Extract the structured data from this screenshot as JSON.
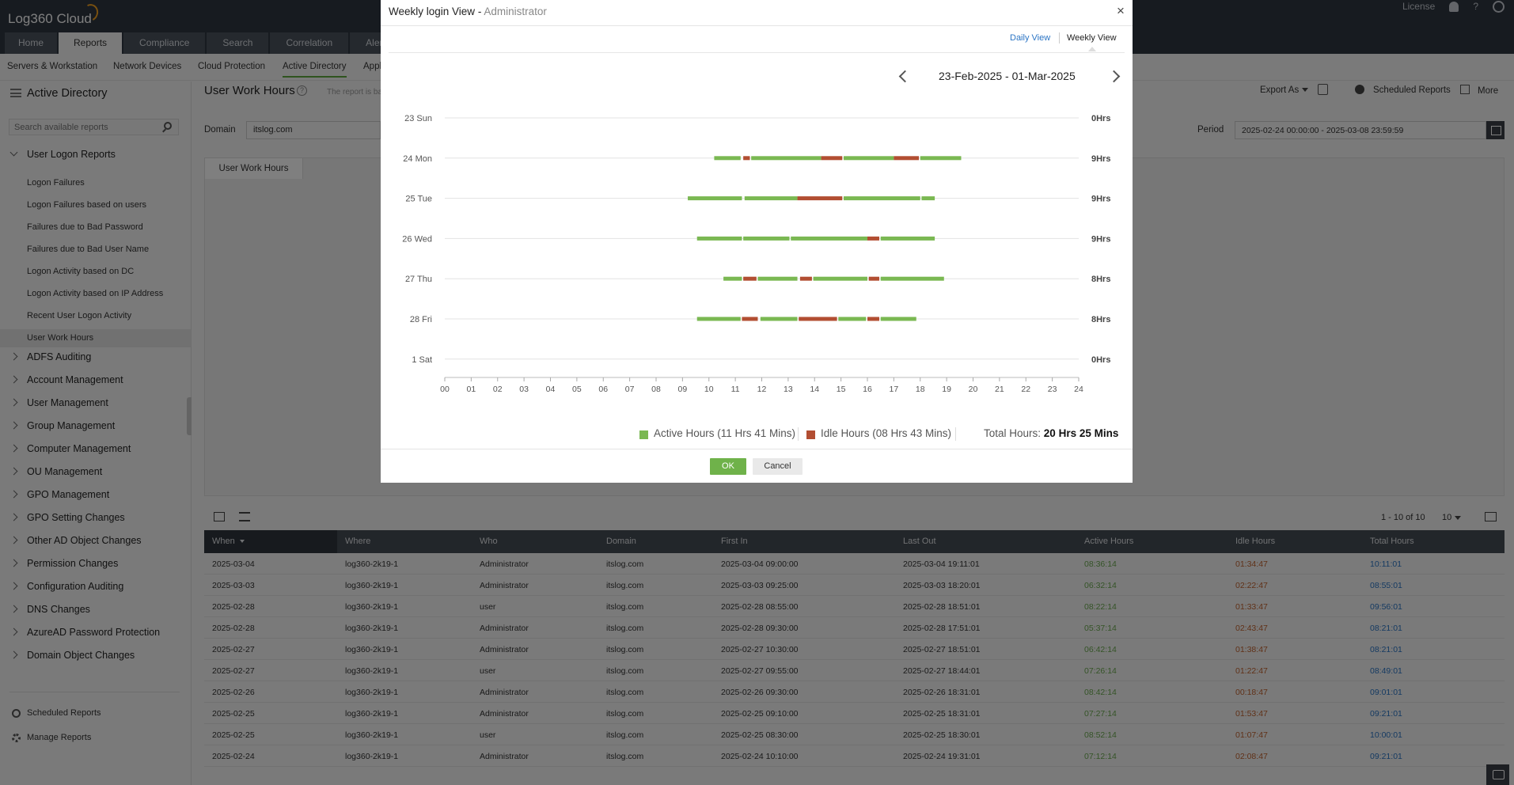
{
  "app": {
    "logo": "Log360 Cloud"
  },
  "header": {
    "tabs": [
      "Home",
      "Reports",
      "Compliance",
      "Search",
      "Correlation",
      "Alerts"
    ],
    "active_tab": "Reports",
    "license_label": "License",
    "help_label": "?"
  },
  "subnav": {
    "items": [
      "Servers & Workstation",
      "Network Devices",
      "Cloud Protection",
      "Active Directory",
      "Appl"
    ],
    "active": "Active Directory"
  },
  "sidebar": {
    "title": "Active Directory",
    "search_placeholder": "Search available reports",
    "expanded_group": "User Logon Reports",
    "sub_items": [
      "Logon Failures",
      "Logon Failures based on users",
      "Failures due to Bad Password",
      "Failures due to Bad User Name",
      "Logon Activity based on DC",
      "Logon Activity based on IP Address",
      "Recent User Logon Activity",
      "User Work Hours"
    ],
    "selected_item": "User Work Hours",
    "groups": [
      "ADFS Auditing",
      "Account Management",
      "User Management",
      "Group Management",
      "Computer Management",
      "OU Management",
      "GPO Management",
      "GPO Setting Changes",
      "Other AD Object Changes",
      "Permission Changes",
      "Configuration Auditing",
      "DNS Changes",
      "AzureAD Password Protection",
      "Domain Object Changes"
    ],
    "footer": [
      "Scheduled Reports",
      "Manage Reports"
    ]
  },
  "main": {
    "title": "User Work Hours",
    "title_note": "The report is ba",
    "export_label": "Export As",
    "scheduled_label": "Scheduled Reports",
    "more_label": "More",
    "domain_label": "Domain",
    "domain_value": "itslog.com",
    "period_label": "Period",
    "period_value": "2025-02-24 00:00:00 - 2025-03-08 23:59:59",
    "panel_tab": "User Work Hours"
  },
  "table": {
    "pager": "1 - 10 of 10",
    "page_size": "10",
    "columns": [
      "When",
      "Where",
      "Who",
      "Domain",
      "First In",
      "Last Out",
      "Active Hours",
      "Idle Hours",
      "Total Hours"
    ],
    "rows": [
      [
        "2025-03-04",
        "log360-2k19-1",
        "Administrator",
        "itslog.com",
        "2025-03-04 09:00:00",
        "2025-03-04 19:11:01",
        "08:36:14",
        "01:34:47",
        "10:11:01"
      ],
      [
        "2025-03-03",
        "log360-2k19-1",
        "Administrator",
        "itslog.com",
        "2025-03-03 09:25:00",
        "2025-03-03 18:20:01",
        "06:32:14",
        "02:22:47",
        "08:55:01"
      ],
      [
        "2025-02-28",
        "log360-2k19-1",
        "user",
        "itslog.com",
        "2025-02-28 08:55:00",
        "2025-02-28 18:51:01",
        "08:22:14",
        "01:33:47",
        "09:56:01"
      ],
      [
        "2025-02-28",
        "log360-2k19-1",
        "Administrator",
        "itslog.com",
        "2025-02-28 09:30:00",
        "2025-02-28 17:51:01",
        "05:37:14",
        "02:43:47",
        "08:21:01"
      ],
      [
        "2025-02-27",
        "log360-2k19-1",
        "Administrator",
        "itslog.com",
        "2025-02-27 10:30:00",
        "2025-02-27 18:51:01",
        "06:42:14",
        "01:38:47",
        "08:21:01"
      ],
      [
        "2025-02-27",
        "log360-2k19-1",
        "user",
        "itslog.com",
        "2025-02-27 09:55:00",
        "2025-02-27 18:44:01",
        "07:26:14",
        "01:22:47",
        "08:49:01"
      ],
      [
        "2025-02-26",
        "log360-2k19-1",
        "Administrator",
        "itslog.com",
        "2025-02-26 09:30:00",
        "2025-02-26 18:31:01",
        "08:42:14",
        "00:18:47",
        "09:01:01"
      ],
      [
        "2025-02-25",
        "log360-2k19-1",
        "Administrator",
        "itslog.com",
        "2025-02-25 09:10:00",
        "2025-02-25 18:31:01",
        "07:27:14",
        "01:53:47",
        "09:21:01"
      ],
      [
        "2025-02-25",
        "log360-2k19-1",
        "user",
        "itslog.com",
        "2025-02-25 08:30:00",
        "2025-02-25 18:30:01",
        "08:52:14",
        "01:07:47",
        "10:00:01"
      ],
      [
        "2025-02-24",
        "log360-2k19-1",
        "Administrator",
        "itslog.com",
        "2025-02-24 10:10:00",
        "2025-02-24 19:31:01",
        "07:12:14",
        "02:08:47",
        "09:21:01"
      ]
    ]
  },
  "modal": {
    "title": "Weekly login View",
    "title_sep": " - ",
    "subtitle": "Administrator",
    "close_label": "×",
    "daily_view": "Daily View",
    "weekly_view": "Weekly View",
    "date_range": "23-Feb-2025 - 01-Mar-2025",
    "legend": {
      "active": "Active Hours (11 Hrs 41 Mins)",
      "idle": "Idle Hours (08 Hrs 43 Mins)",
      "total_label": "Total Hours:",
      "total_value": "20 Hrs 25 Mins"
    },
    "ok_label": "OK",
    "cancel_label": "Cancel"
  },
  "colors": {
    "active": "#7ab852",
    "idle": "#b24e32",
    "accent": "#2a74c4",
    "header_bg": "#2e3640"
  },
  "chart_data": {
    "type": "timeline",
    "x_ticks": [
      "00",
      "01",
      "02",
      "03",
      "04",
      "05",
      "06",
      "07",
      "08",
      "09",
      "10",
      "11",
      "12",
      "13",
      "14",
      "15",
      "16",
      "17",
      "18",
      "19",
      "20",
      "21",
      "22",
      "23",
      "24"
    ],
    "xlim": [
      0,
      24
    ],
    "days": [
      {
        "label": "23 Sun",
        "total": "0Hrs",
        "segments": []
      },
      {
        "label": "24 Mon",
        "total": "9Hrs",
        "segments": [
          {
            "start": 10.2,
            "end": 11.2,
            "state": "active"
          },
          {
            "start": 11.3,
            "end": 11.55,
            "state": "idle"
          },
          {
            "start": 11.6,
            "end": 14.25,
            "state": "active"
          },
          {
            "start": 14.25,
            "end": 15.05,
            "state": "idle"
          },
          {
            "start": 15.1,
            "end": 17.0,
            "state": "active"
          },
          {
            "start": 17.0,
            "end": 17.95,
            "state": "idle"
          },
          {
            "start": 18.0,
            "end": 19.55,
            "state": "active"
          }
        ]
      },
      {
        "label": "25 Tue",
        "total": "9Hrs",
        "segments": [
          {
            "start": 9.2,
            "end": 11.25,
            "state": "active"
          },
          {
            "start": 11.35,
            "end": 13.35,
            "state": "active"
          },
          {
            "start": 13.35,
            "end": 15.05,
            "state": "idle"
          },
          {
            "start": 15.1,
            "end": 18.0,
            "state": "active"
          },
          {
            "start": 18.05,
            "end": 18.55,
            "state": "active"
          }
        ]
      },
      {
        "label": "26 Wed",
        "total": "9Hrs",
        "segments": [
          {
            "start": 9.55,
            "end": 11.25,
            "state": "active"
          },
          {
            "start": 11.3,
            "end": 13.05,
            "state": "active"
          },
          {
            "start": 13.1,
            "end": 16.0,
            "state": "active"
          },
          {
            "start": 16.0,
            "end": 16.45,
            "state": "idle"
          },
          {
            "start": 16.5,
            "end": 18.55,
            "state": "active"
          }
        ]
      },
      {
        "label": "27 Thu",
        "total": "8Hrs",
        "segments": [
          {
            "start": 10.55,
            "end": 11.25,
            "state": "active"
          },
          {
            "start": 11.3,
            "end": 11.8,
            "state": "idle"
          },
          {
            "start": 11.85,
            "end": 13.35,
            "state": "active"
          },
          {
            "start": 13.45,
            "end": 13.9,
            "state": "idle"
          },
          {
            "start": 13.95,
            "end": 16.0,
            "state": "active"
          },
          {
            "start": 16.05,
            "end": 16.45,
            "state": "idle"
          },
          {
            "start": 16.5,
            "end": 18.9,
            "state": "active"
          }
        ]
      },
      {
        "label": "28 Fri",
        "total": "8Hrs",
        "segments": [
          {
            "start": 9.55,
            "end": 11.2,
            "state": "active"
          },
          {
            "start": 11.25,
            "end": 11.85,
            "state": "idle"
          },
          {
            "start": 11.95,
            "end": 13.35,
            "state": "active"
          },
          {
            "start": 13.4,
            "end": 14.85,
            "state": "idle"
          },
          {
            "start": 14.9,
            "end": 15.95,
            "state": "active"
          },
          {
            "start": 16.0,
            "end": 16.45,
            "state": "idle"
          },
          {
            "start": 16.5,
            "end": 17.85,
            "state": "active"
          }
        ]
      },
      {
        "label": "1 Sat",
        "total": "0Hrs",
        "segments": []
      }
    ],
    "legend": [
      "Active Hours (11 Hrs 41 Mins)",
      "Idle Hours (08 Hrs 43 Mins)"
    ]
  }
}
